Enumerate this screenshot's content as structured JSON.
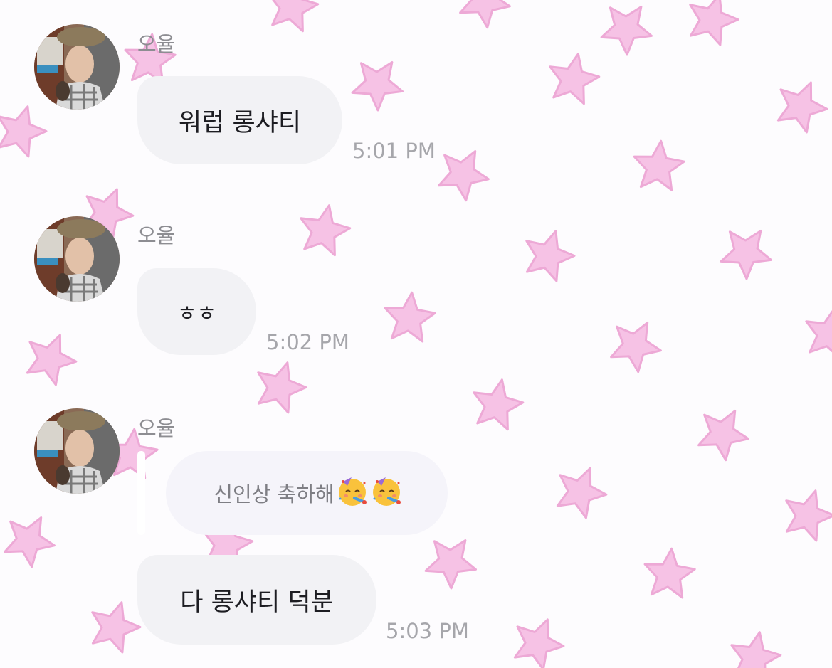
{
  "colors": {
    "star": "#f6c2e5",
    "star_stroke": "#eda9d6",
    "background": "#fdfcfe",
    "bubble": "#f2f2f5",
    "reply_bubble": "#f5f4fa",
    "sender_text": "#8d8d92",
    "time_text": "#a6a6ab"
  },
  "messages": [
    {
      "sender": "오율",
      "text": "워럽 롱샤티",
      "time": "5:01 PM"
    },
    {
      "sender": "오율",
      "text": "ㅎㅎ",
      "time": "5:02 PM"
    },
    {
      "sender": "오율",
      "reply_to": {
        "text": "신인상 축하해",
        "emojis": [
          "partying-face-emoji",
          "partying-face-emoji"
        ]
      },
      "text": "다 롱샤티 덕분",
      "time": "5:03 PM"
    }
  ],
  "background_pattern": "pink-star-pattern"
}
